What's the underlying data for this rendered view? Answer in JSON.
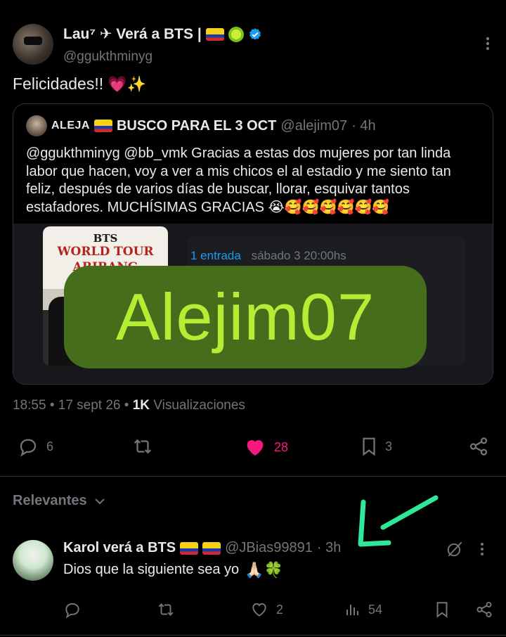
{
  "tweet": {
    "author_name": "Lau⁷ ✈ Verá a BTS |",
    "author_handle": "@ggukthminyg",
    "text": "Felicidades!!",
    "text_emojis": "💗✨",
    "timestamp": "18:55 • 17 sept 26 •",
    "views_count": "1K",
    "views_label": "Visualizaciones"
  },
  "quote": {
    "author_name": "ALEJA",
    "title": "BUSCO PARA EL 3 OCT",
    "handle": "@alejim07",
    "time": "· 4h",
    "body": "@ggukthminyg @bb_vmk Gracias a estas dos mujeres por tan linda labor que hacen, voy a ver a mis chicos el al estadio y me siento tan feliz, después de varios días de buscar, llorar, esquivar tantos estafadores. MUCHÍSIMAS GRACIAS 😭🥰🥰🥰🥰🥰🥰",
    "poster_line1": "BTS",
    "poster_line2": "WORLD TOUR",
    "poster_line3": "ARIRANG",
    "ticket_qty": "1 entrada",
    "ticket_date": "sábado 3 20:00hs",
    "overlay_text": "Alejim07"
  },
  "actions": {
    "reply_count": "6",
    "like_count": "28",
    "bookmark_count": "3"
  },
  "relevantes_label": "Relevantes",
  "reply": {
    "author_name": "Karol verá a BTS",
    "handle": "@JBias99891",
    "time": "· 3h",
    "text": "Dios que la siguiente sea yo",
    "text_emojis": "🙏🏻🍀",
    "like_count": "2",
    "views_count": "54"
  },
  "colors": {
    "background": "#000000",
    "text": "#e7e9ea",
    "muted": "#71767b",
    "like": "#f91880",
    "link": "#1d9bf0",
    "overlay_bg": "#456d1b",
    "overlay_text": "#b4ee34",
    "arrow": "#2ee89a"
  }
}
